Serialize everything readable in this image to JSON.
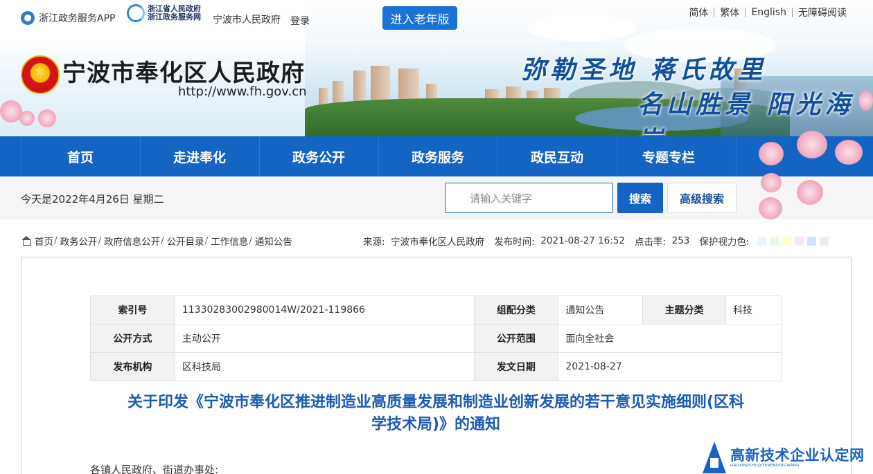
{
  "topbar": {
    "app_label": "浙江政务服务APP",
    "zj_logo_line1": "浙江省人民政府",
    "zj_logo_line2": "浙江政务服务网",
    "city_gov": "宁波市人民政府",
    "login": "登录",
    "elder_mode": "进入老年版",
    "links": [
      "简体",
      "繁体",
      "English",
      "无障碍阅读"
    ]
  },
  "header": {
    "title": "宁波市奉化区人民政府",
    "url": "http://www.fh.gov.cn",
    "slogan_line1": "弥勒圣地 蒋氏故里",
    "slogan_line2": "名山胜景 阳光海岸"
  },
  "nav": {
    "items": [
      "首页",
      "走进奉化",
      "政务公开",
      "政务服务",
      "政民互动",
      "专题专栏"
    ]
  },
  "datebar": {
    "today": "今天是2022年4月26日  星期二",
    "search_placeholder": "请输入关键字",
    "search_button": "搜索",
    "advanced_button": "高级搜索"
  },
  "breadcrumb": [
    "首页",
    "政务公开",
    "政府信息公开",
    "公开目录",
    "工作信息",
    "通知公告"
  ],
  "meta": {
    "source_label": "来源:",
    "source": "宁波市奉化区人民政府",
    "time_label": "发布时间:",
    "time": "2021-08-27 16:52",
    "clicks_label": "点击率:",
    "clicks": "253",
    "eye_label": "保护视力色:",
    "eye_colors": [
      "#e6f7ff",
      "#e8fbe8",
      "#ffffcc",
      "#fce4fa",
      "#cfe5ff",
      "#eeeeee"
    ]
  },
  "info_table": {
    "index_label": "索引号",
    "index": "11330283002980014W/2021-119866",
    "category_label": "组配分类",
    "category": "通知公告",
    "topic_label": "主题分类",
    "topic": "科技",
    "mode_label": "公开方式",
    "mode": "主动公开",
    "scope_label": "公开范围",
    "scope": "面向全社会",
    "org_label": "发布机构",
    "org": "区科技局",
    "date_label": "发文日期",
    "date": "2021-08-27"
  },
  "document": {
    "title_line1": "关于印发《宁波市奉化区推进制造业高质量发展和制造业创新发展的若干意见实施细则(区科",
    "title_line2": "学技术局)》的通知",
    "salutation": "各镇人民政府、街道办事处:"
  },
  "watermark": {
    "name": "高新技术企业认定网",
    "pinyin": "GAOXINJISHUQIYERENDINGWANG"
  },
  "colors": {
    "nav_blue": "#1464c3",
    "title_blue": "#1a5bb3"
  }
}
